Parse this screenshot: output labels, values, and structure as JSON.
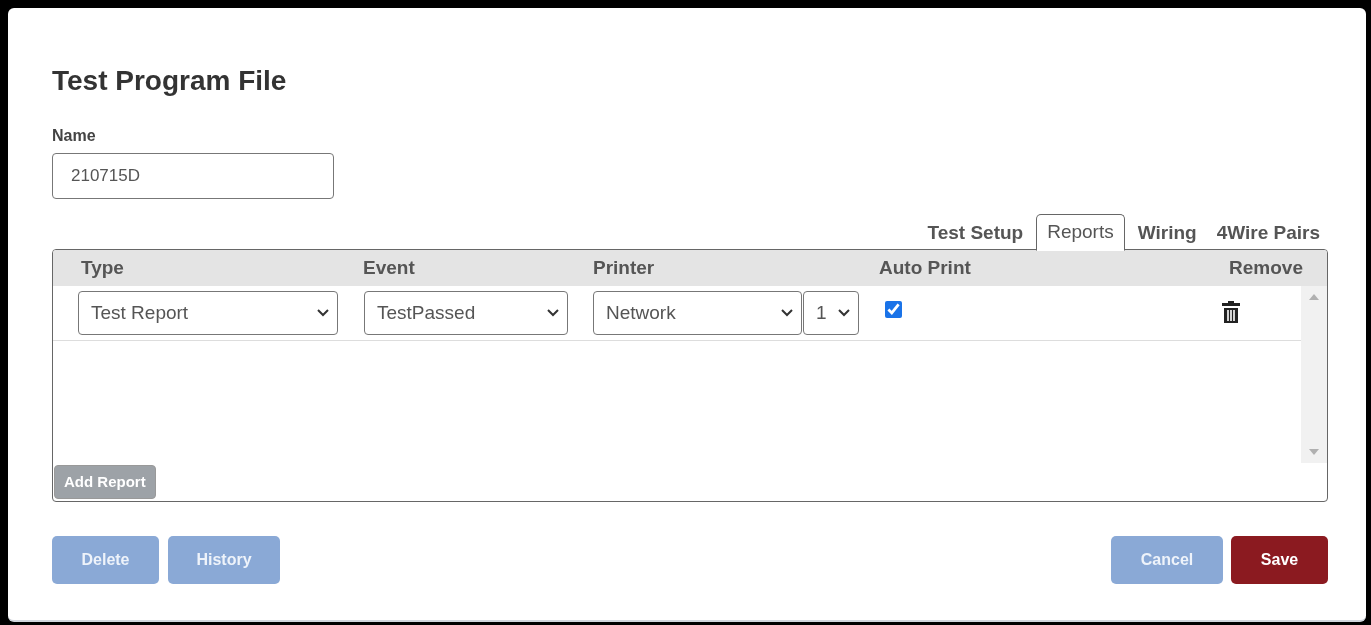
{
  "dialog": {
    "title": "Test Program File"
  },
  "name_field": {
    "label": "Name",
    "value": "210715D"
  },
  "tabs": [
    {
      "label": "Test Setup",
      "selected": false
    },
    {
      "label": "Reports",
      "selected": true
    },
    {
      "label": "Wiring",
      "selected": false
    },
    {
      "label": "4Wire Pairs",
      "selected": false
    }
  ],
  "table": {
    "columns": [
      "Type",
      "Event",
      "Printer",
      "Auto Print",
      "Remove"
    ],
    "rows": [
      {
        "type": "Test Report",
        "event": "TestPassed",
        "printer": "Network",
        "copies": "1",
        "auto_print": true
      }
    ]
  },
  "add_button": {
    "label": "Add Report",
    "disabled": true
  },
  "left_buttons": [
    {
      "label": "Delete",
      "disabled": true
    },
    {
      "label": "History",
      "disabled": true
    }
  ],
  "right_buttons": [
    {
      "label": "Cancel",
      "kind": "secondary",
      "disabled": true
    },
    {
      "label": "Save",
      "kind": "primary",
      "disabled": false
    }
  ]
}
